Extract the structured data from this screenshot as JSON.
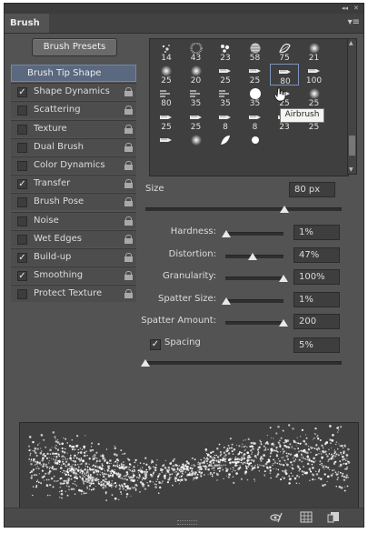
{
  "panel": {
    "tab_label": "Brush",
    "menu_icon": "panel-menu-icon",
    "collapse_icon": "double-arrow-icon",
    "close_icon": "close-icon"
  },
  "presets_button": "Brush Presets",
  "options": [
    {
      "label": "Brush Tip Shape",
      "selected": true,
      "checkbox": false
    },
    {
      "label": "Shape Dynamics",
      "checked": true,
      "lock": true
    },
    {
      "label": "Scattering",
      "checked": false,
      "lock": true
    },
    {
      "label": "Texture",
      "checked": false,
      "lock": true
    },
    {
      "label": "Dual Brush",
      "checked": false,
      "lock": true
    },
    {
      "label": "Color Dynamics",
      "checked": false,
      "lock": true
    },
    {
      "label": "Transfer",
      "checked": true,
      "lock": true
    },
    {
      "label": "Brush Pose",
      "checked": false,
      "lock": true
    },
    {
      "label": "Noise",
      "checked": false,
      "lock": true
    },
    {
      "label": "Wet Edges",
      "checked": false,
      "lock": true
    },
    {
      "label": "Build-up",
      "checked": true,
      "lock": true
    },
    {
      "label": "Smoothing",
      "checked": true,
      "lock": true
    },
    {
      "label": "Protect Texture",
      "checked": false,
      "lock": true
    }
  ],
  "brushes": [
    {
      "size": "14",
      "kind": "splatter"
    },
    {
      "size": "43",
      "kind": "spray"
    },
    {
      "size": "23",
      "kind": "scatter"
    },
    {
      "size": "58",
      "kind": "texture"
    },
    {
      "size": "75",
      "kind": "leaf"
    },
    {
      "size": "21",
      "kind": "soft"
    },
    {
      "size": "25",
      "kind": "soft"
    },
    {
      "size": "20",
      "kind": "soft"
    },
    {
      "size": "25",
      "kind": "airbrush"
    },
    {
      "size": "25",
      "kind": "airbrush"
    },
    {
      "size": "80",
      "kind": "airbrush",
      "highlight": true
    },
    {
      "size": "100",
      "kind": "airbrush"
    },
    {
      "size": "80",
      "kind": "stroke"
    },
    {
      "size": "35",
      "kind": "stroke"
    },
    {
      "size": "35",
      "kind": "stroke"
    },
    {
      "size": "35",
      "kind": "hard"
    },
    {
      "size": "25",
      "kind": "airbrush"
    },
    {
      "size": "25",
      "kind": "soft"
    },
    {
      "size": "25",
      "kind": "airbrush"
    },
    {
      "size": "25",
      "kind": "airbrush"
    },
    {
      "size": "8",
      "kind": "airbrush"
    },
    {
      "size": "8",
      "kind": "airbrush"
    },
    {
      "size": "23",
      "kind": "airbrush"
    },
    {
      "size": "25",
      "kind": "hard"
    },
    {
      "size": "",
      "kind": "airbrush"
    },
    {
      "size": "",
      "kind": "soft"
    },
    {
      "size": "",
      "kind": "leaf-white"
    },
    {
      "size": "",
      "kind": "hard-small"
    }
  ],
  "tooltip": "Airbrush",
  "size": {
    "label": "Size",
    "value": "80 px",
    "fraction": 0.8
  },
  "airbrush_options": [
    {
      "label": "Hardness:",
      "value": "1%",
      "fraction": 0.01
    },
    {
      "label": "Distortion:",
      "value": "47%",
      "fraction": 0.47
    },
    {
      "label": "Granularity:",
      "value": "100%",
      "fraction": 1.0
    },
    {
      "label": "Spatter Size:",
      "value": "1%",
      "fraction": 0.01
    },
    {
      "label": "Spatter Amount:",
      "value": "200",
      "fraction": 1.0
    }
  ],
  "spacing": {
    "label": "Spacing",
    "value": "5%",
    "checked": true,
    "fraction": 0.0
  },
  "bottom_icons": [
    "toggle-brush-preview-icon",
    "grid-view-icon",
    "new-brush-icon"
  ]
}
